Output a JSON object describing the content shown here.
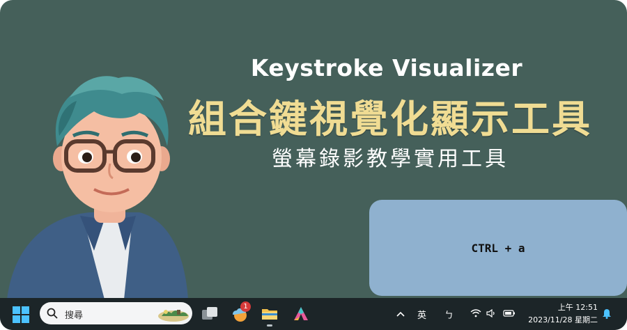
{
  "banner": {
    "title_en": "Keystroke Visualizer",
    "title_zh": "組合鍵視覺化顯示工具",
    "subtitle_zh": "螢幕錄影教學實用工具"
  },
  "key_overlay": {
    "combo": "CTRL + a"
  },
  "taskbar": {
    "search_label": "搜尋",
    "pinned_apps": [
      {
        "name": "task-view-icon"
      },
      {
        "name": "weather-app-icon",
        "badge": "1"
      },
      {
        "name": "file-explorer-icon"
      },
      {
        "name": "arc-app-icon"
      }
    ],
    "tray": {
      "input_mode": "英",
      "ime_mode": "ㄅ",
      "time": "上午 12:51",
      "date": "2023/11/28 星期二"
    }
  },
  "colors": {
    "background": "#45605a",
    "title_zh": "#f0dc93",
    "key_panel": "#8fb1cf",
    "taskbar": "#1c2528"
  }
}
